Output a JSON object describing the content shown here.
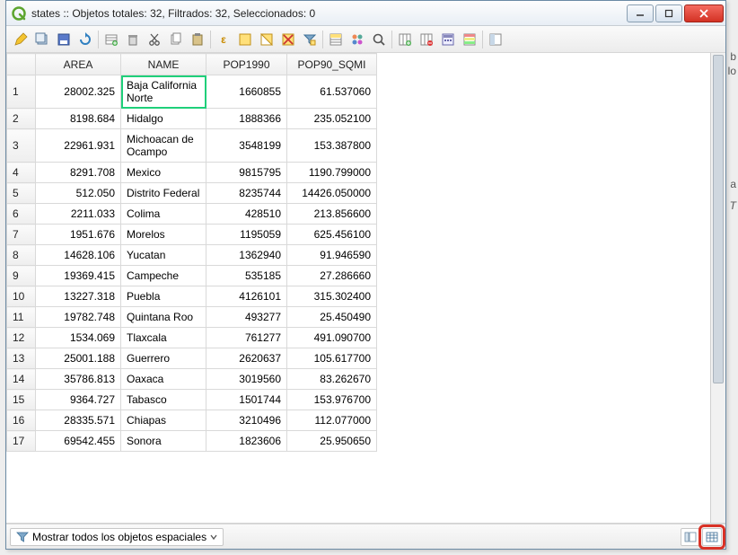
{
  "window": {
    "title": "states :: Objetos totales: 32, Filtrados: 32, Seleccionados: 0"
  },
  "toolbar": {
    "icons": [
      "pencil-icon",
      "multi-edit-icon",
      "save-icon",
      "reload-icon",
      "sep",
      "new-row-icon",
      "delete-icon",
      "cut-icon",
      "copy-icon",
      "paste-icon",
      "sep",
      "expr-selection-icon",
      "select-all-icon",
      "invert-selection-icon",
      "deselect-icon",
      "filter-selection-icon",
      "sep",
      "selection-to-top-icon",
      "pan-to-icon",
      "zoom-to-icon",
      "sep",
      "new-field-icon",
      "delete-field-icon",
      "field-calc-icon",
      "conditional-format-icon",
      "sep",
      "dock-icon"
    ]
  },
  "table": {
    "columns": [
      "AREA",
      "NAME",
      "POP1990",
      "POP90_SQMI"
    ],
    "highlight_row": 0,
    "highlight_col": 1,
    "rows": [
      {
        "n": "1",
        "AREA": "28002.325",
        "NAME": "Baja California Norte",
        "POP1990": "1660855",
        "POP90_SQMI": "61.537060"
      },
      {
        "n": "2",
        "AREA": "8198.684",
        "NAME": "Hidalgo",
        "POP1990": "1888366",
        "POP90_SQMI": "235.052100"
      },
      {
        "n": "3",
        "AREA": "22961.931",
        "NAME": "Michoacan de Ocampo",
        "POP1990": "3548199",
        "POP90_SQMI": "153.387800"
      },
      {
        "n": "4",
        "AREA": "8291.708",
        "NAME": "Mexico",
        "POP1990": "9815795",
        "POP90_SQMI": "1190.799000"
      },
      {
        "n": "5",
        "AREA": "512.050",
        "NAME": "Distrito Federal",
        "POP1990": "8235744",
        "POP90_SQMI": "14426.050000"
      },
      {
        "n": "6",
        "AREA": "2211.033",
        "NAME": "Colima",
        "POP1990": "428510",
        "POP90_SQMI": "213.856600"
      },
      {
        "n": "7",
        "AREA": "1951.676",
        "NAME": "Morelos",
        "POP1990": "1195059",
        "POP90_SQMI": "625.456100"
      },
      {
        "n": "8",
        "AREA": "14628.106",
        "NAME": "Yucatan",
        "POP1990": "1362940",
        "POP90_SQMI": "91.946590"
      },
      {
        "n": "9",
        "AREA": "19369.415",
        "NAME": "Campeche",
        "POP1990": "535185",
        "POP90_SQMI": "27.286660"
      },
      {
        "n": "10",
        "AREA": "13227.318",
        "NAME": "Puebla",
        "POP1990": "4126101",
        "POP90_SQMI": "315.302400"
      },
      {
        "n": "11",
        "AREA": "19782.748",
        "NAME": "Quintana Roo",
        "POP1990": "493277",
        "POP90_SQMI": "25.450490"
      },
      {
        "n": "12",
        "AREA": "1534.069",
        "NAME": "Tlaxcala",
        "POP1990": "761277",
        "POP90_SQMI": "491.090700"
      },
      {
        "n": "13",
        "AREA": "25001.188",
        "NAME": "Guerrero",
        "POP1990": "2620637",
        "POP90_SQMI": "105.617700"
      },
      {
        "n": "14",
        "AREA": "35786.813",
        "NAME": "Oaxaca",
        "POP1990": "3019560",
        "POP90_SQMI": "83.262670"
      },
      {
        "n": "15",
        "AREA": "9364.727",
        "NAME": "Tabasco",
        "POP1990": "1501744",
        "POP90_SQMI": "153.976700"
      },
      {
        "n": "16",
        "AREA": "28335.571",
        "NAME": "Chiapas",
        "POP1990": "3210496",
        "POP90_SQMI": "112.077000"
      },
      {
        "n": "17",
        "AREA": "69542.455",
        "NAME": "Sonora",
        "POP1990": "1823606",
        "POP90_SQMI": "25.950650"
      }
    ]
  },
  "statusbar": {
    "filter_label": "Mostrar todos los objetos espaciales"
  },
  "external": {
    "a": "a",
    "t": "T",
    "b": "b",
    "lo": "lo"
  }
}
